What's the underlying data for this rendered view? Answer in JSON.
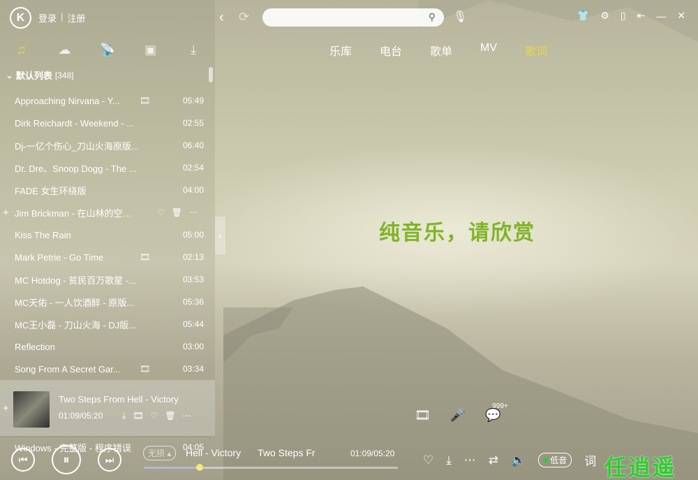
{
  "header": {
    "logo_letter": "K",
    "login": "登录",
    "register": "注册",
    "sep": "|"
  },
  "categories": [
    {
      "icon": "music-note-icon",
      "glyph": "♫",
      "active": true
    },
    {
      "icon": "cloud-icon",
      "glyph": "☁",
      "active": false
    },
    {
      "icon": "radio-icon",
      "glyph": "📡",
      "active": false
    },
    {
      "icon": "device-icon",
      "glyph": "▣",
      "active": false
    },
    {
      "icon": "download-icon",
      "glyph": "⤓",
      "active": false
    }
  ],
  "playlist": {
    "name": "默认列表",
    "count": "[348]",
    "expand_glyph": "⌄"
  },
  "songs": [
    {
      "title": "Approaching Nirvana - Y...",
      "mv": true,
      "duration": "05:49"
    },
    {
      "title": "Dirk Reichardt - Weekend - ...",
      "mv": false,
      "duration": "02:55"
    },
    {
      "title": "Dj-一亿个伤心_刀山火海原版...",
      "mv": false,
      "duration": "06:40"
    },
    {
      "title": "Dr. Dre、Snoop Dogg - The ...",
      "mv": false,
      "duration": "02:54"
    },
    {
      "title": "FADE 女生环绕版",
      "mv": false,
      "duration": "04:00"
    },
    {
      "title": "Jim Brickman - 在山林的空气中",
      "mv": false,
      "duration": "",
      "hover": true
    },
    {
      "title": "Kiss The Rain",
      "mv": false,
      "duration": "05:00"
    },
    {
      "title": "Mark Petrie - Go Time",
      "mv": true,
      "duration": "02:13"
    },
    {
      "title": "MC Hotdog - 贫民百万歌星 -...",
      "mv": false,
      "duration": "03:53"
    },
    {
      "title": "MC天佑 - 一人饮酒醉 - 原版...",
      "mv": false,
      "duration": "05:36"
    },
    {
      "title": "MC王小磊 - 刀山火海 - DJ版...",
      "mv": false,
      "duration": "05:44"
    },
    {
      "title": "Reflection",
      "mv": false,
      "duration": "03:00"
    },
    {
      "title": "Song From A Secret Gar...",
      "mv": true,
      "duration": "03:34"
    }
  ],
  "now_playing_row": {
    "title": "Two Steps From Hell - Victory",
    "time": "01:09/05:20"
  },
  "last_song": {
    "title": "Windows - 完整版 - 程序错误",
    "duration": "04:05"
  },
  "search": {
    "placeholder": ""
  },
  "tabs": [
    {
      "label": "乐库",
      "active": false
    },
    {
      "label": "电台",
      "active": false
    },
    {
      "label": "歌单",
      "active": false
    },
    {
      "label": "MV",
      "active": false
    },
    {
      "label": "歌词",
      "active": true
    }
  ],
  "lyric": {
    "message": "纯音乐，请欣赏",
    "comment_count": "999+"
  },
  "player": {
    "quality_label": "无损",
    "marquee": [
      "Hell - Victory",
      "Two Steps Fr"
    ],
    "time": "01:09/05:20",
    "progress": 0.22,
    "hq_label": "低音",
    "lyric_btn": "词"
  },
  "watermark": "任逍遥"
}
